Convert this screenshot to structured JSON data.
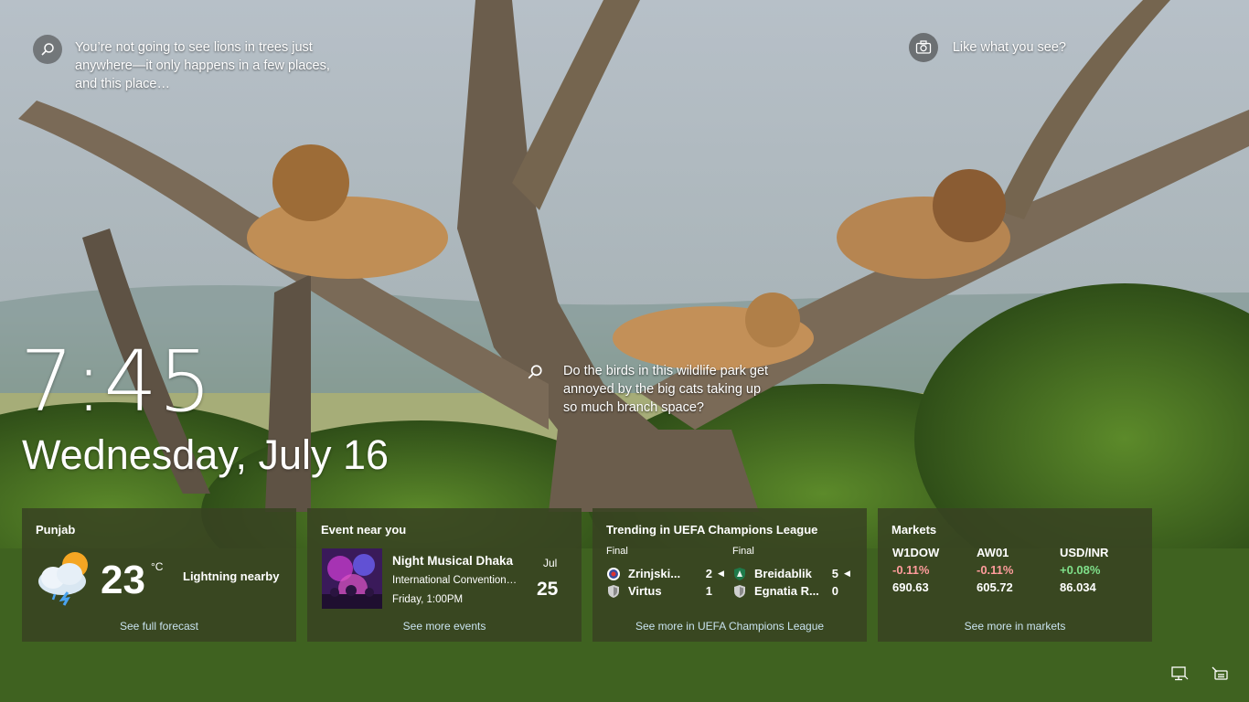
{
  "spotlight": {
    "top_left_text": "You’re not going to see lions in trees just anywhere—it only happens in a few places, and this place…",
    "top_left_icon": "search-icon",
    "top_right_text": "Like what you see?",
    "top_right_icon": "camera-icon",
    "middle_text": "Do the birds in this wildlife park get annoyed by the big cats taking up so much branch space?",
    "middle_icon": "search-icon"
  },
  "clock": {
    "time": "7:45",
    "date": "Wednesday, July 16"
  },
  "weather_card": {
    "location": "Punjab",
    "temperature": "23",
    "unit": "°C",
    "condition": "Lightning nearby",
    "icon": "cloud-sun-rain-icon",
    "footer_link": "See full forecast"
  },
  "event_card": {
    "title": "Event near you",
    "event_name": "Night Musical Dhaka",
    "venue": "International Convention…",
    "when": "Friday, 1:00PM",
    "month": "Jul",
    "day": "25",
    "footer_link": "See more events"
  },
  "sports_card": {
    "title": "Trending in UEFA Champions League",
    "matches": [
      {
        "status": "Final",
        "teams": [
          {
            "name": "Zrinjski...",
            "score": "2",
            "winner": true
          },
          {
            "name": "Virtus",
            "score": "1",
            "winner": false
          }
        ]
      },
      {
        "status": "Final",
        "teams": [
          {
            "name": "Breidablik",
            "score": "5",
            "winner": true
          },
          {
            "name": "Egnatia R...",
            "score": "0",
            "winner": false
          }
        ]
      }
    ],
    "footer_link": "See more in UEFA Champions League"
  },
  "markets_card": {
    "title": "Markets",
    "items": [
      {
        "symbol": "W1DOW",
        "change": "-0.11%",
        "value": "690.63",
        "direction": "down"
      },
      {
        "symbol": "AW01",
        "change": "-0.11%",
        "value": "605.72",
        "direction": "down"
      },
      {
        "symbol": "USD/INR",
        "change": "+0.08%",
        "value": "86.034",
        "direction": "up"
      }
    ],
    "footer_link": "See more in markets"
  },
  "tray": {
    "network_icon": "network-icon",
    "accessibility_icon": "ease-of-access-icon"
  },
  "colors": {
    "card_bg": "#384222",
    "link": "#c9e3ef",
    "negative": "#ff9c9c",
    "positive": "#7fe08a"
  }
}
